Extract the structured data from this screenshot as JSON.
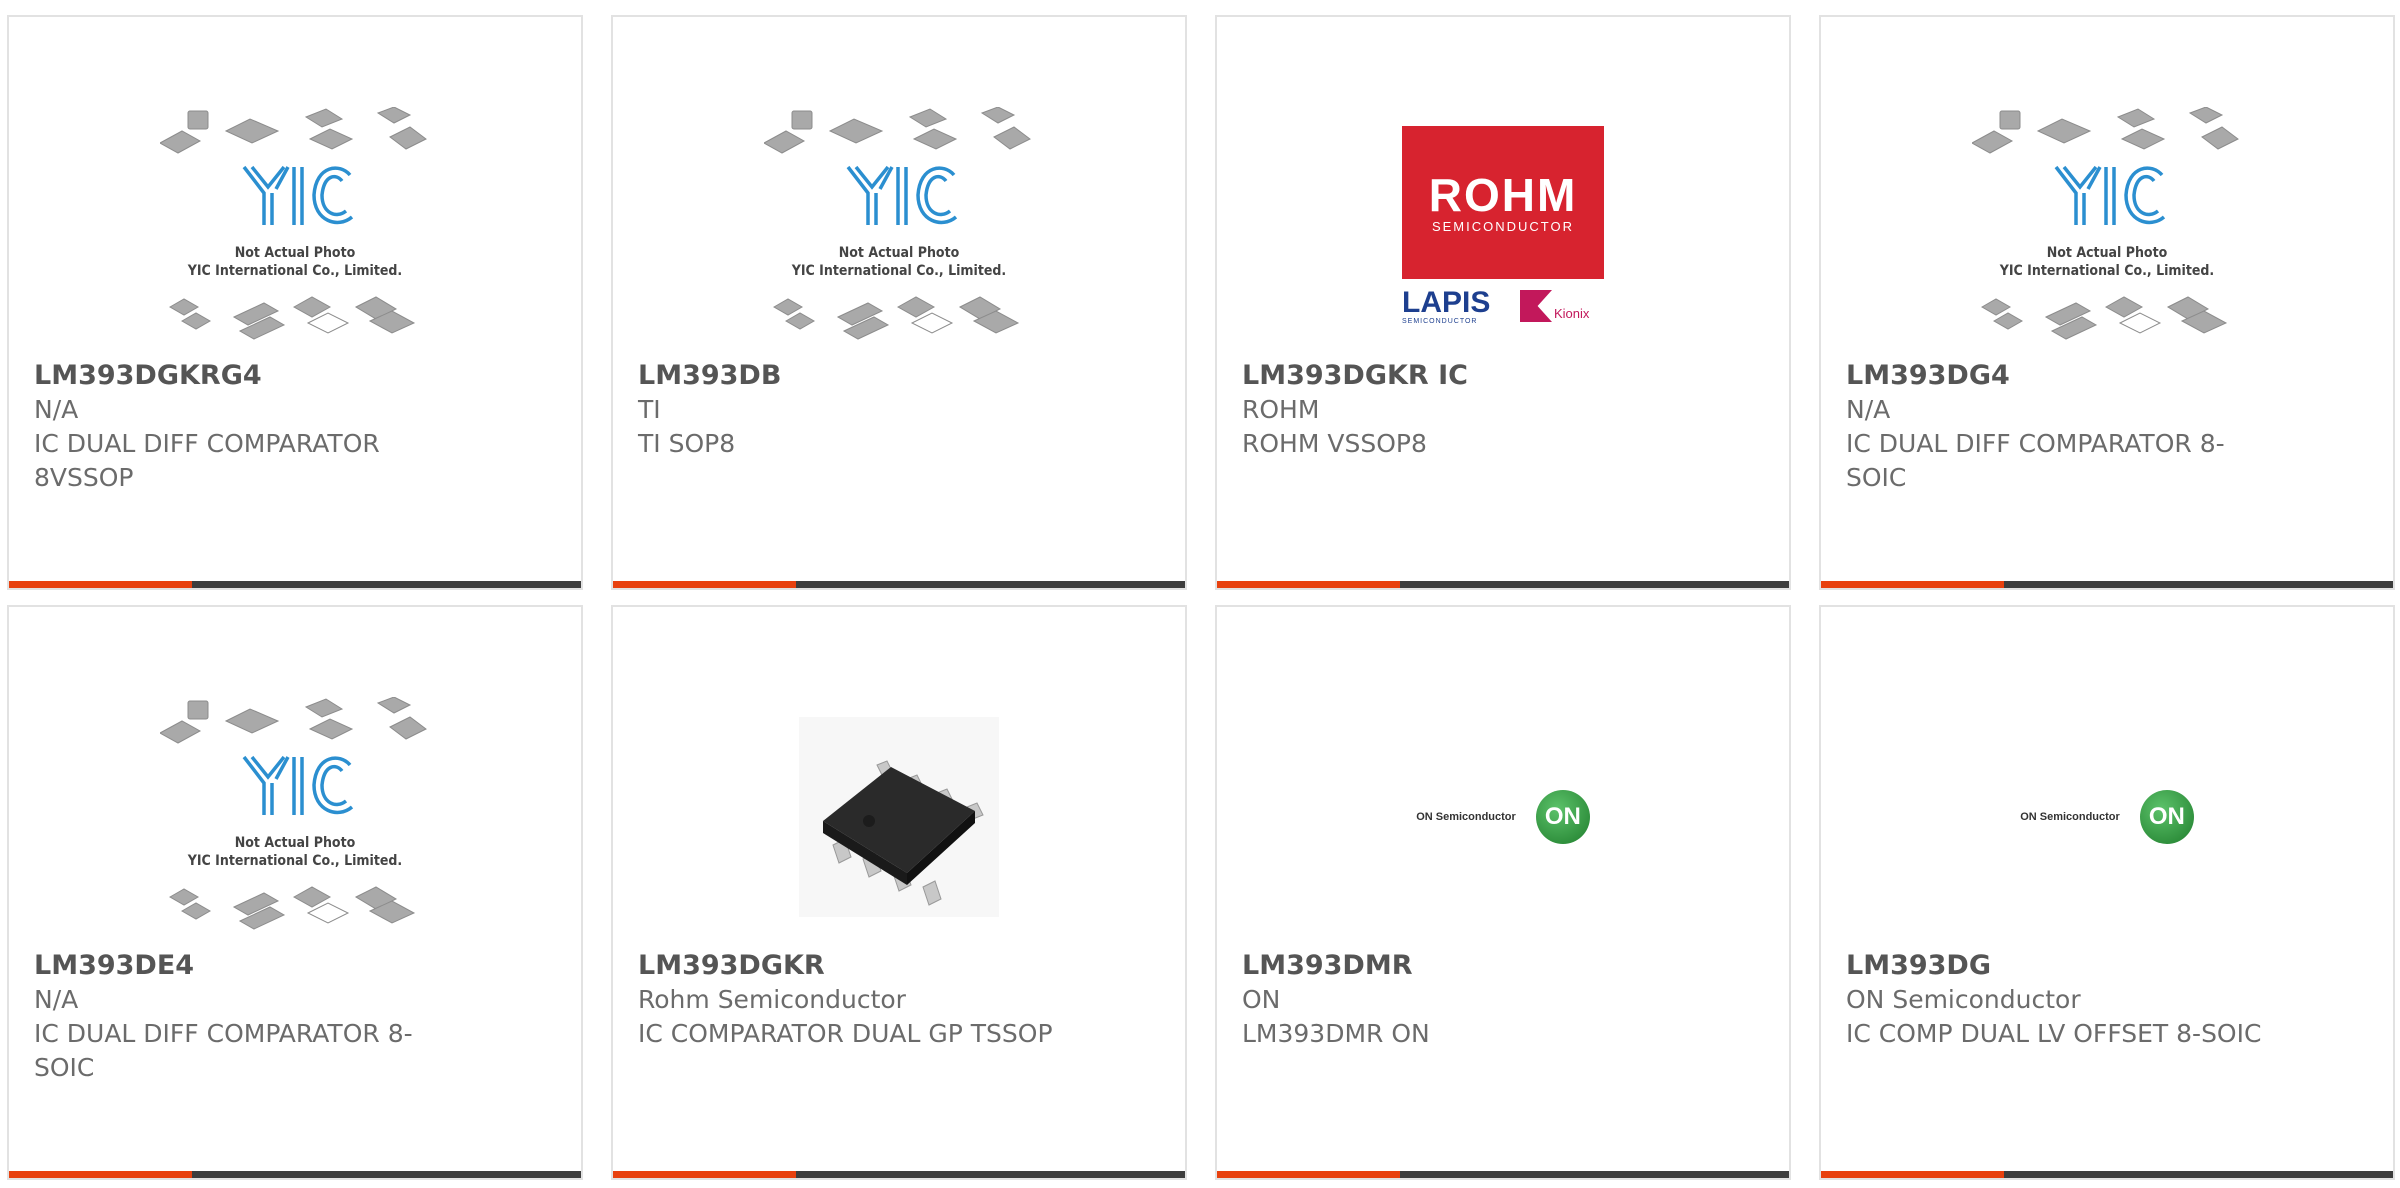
{
  "colors": {
    "accent": "#e8410f",
    "bar": "#3d3d3d",
    "rohm_red": "#d7232f",
    "yic_blue": "#2b8fd0",
    "on_green": "#2f9a3b"
  },
  "products": [
    {
      "part": "LM393DGKRG4",
      "manufacturer": "N/A",
      "description": "IC DUAL DIFF COMPARATOR 8VSSOP",
      "image": "yic-placeholder"
    },
    {
      "part": "LM393DB",
      "manufacturer": "TI",
      "description": "TI SOP8",
      "image": "yic-placeholder"
    },
    {
      "part": "LM393DGKR IC",
      "manufacturer": "ROHM",
      "description": "ROHM VSSOP8",
      "image": "rohm-logo"
    },
    {
      "part": "LM393DG4",
      "manufacturer": "N/A",
      "description": "IC DUAL DIFF COMPARATOR 8-SOIC",
      "image": "yic-placeholder"
    },
    {
      "part": "LM393DE4",
      "manufacturer": "N/A",
      "description": "IC DUAL DIFF COMPARATOR 8-SOIC",
      "image": "yic-placeholder"
    },
    {
      "part": "LM393DGKR",
      "manufacturer": "Rohm Semiconductor",
      "description": "IC COMPARATOR DUAL GP TSSOP",
      "image": "chip-photo"
    },
    {
      "part": "LM393DMR",
      "manufacturer": "ON",
      "description": "LM393DMR ON",
      "image": "on-semi-logo"
    },
    {
      "part": "LM393DG",
      "manufacturer": "ON Semiconductor",
      "description": "IC COMP DUAL LV OFFSET 8-SOIC",
      "image": "on-semi-logo"
    }
  ],
  "yic_placeholder": {
    "logo_text": "YIC",
    "line1": "Not Actual Photo",
    "line2": "YIC International Co., Limited."
  },
  "rohm_logo": {
    "brand": "ROHM",
    "sub": "SEMICONDUCTOR",
    "lapis": "LAPIS",
    "lapis_sub": "SEMICONDUCTOR",
    "kionix": "Kionix"
  },
  "on_logo": {
    "text": "ON Semiconductor",
    "badge": "ON"
  }
}
